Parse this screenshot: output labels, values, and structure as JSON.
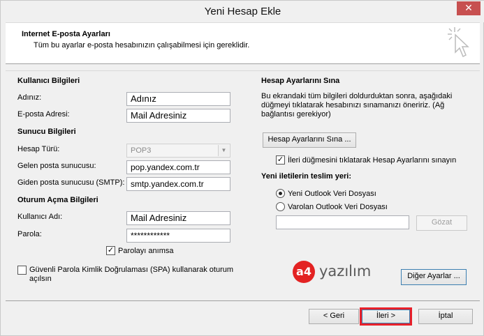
{
  "window": {
    "title": "Yeni Hesap Ekle",
    "close_label": "✕"
  },
  "header": {
    "title": "Internet E-posta Ayarları",
    "subtitle": "Tüm bu ayarlar e-posta hesabınızın çalışabilmesi için gereklidir."
  },
  "left": {
    "user_section": "Kullanıcı Bilgileri",
    "name_label": "Adınız:",
    "name_value": "Adınız",
    "email_label": "E-posta Adresi:",
    "email_value": "Mail Adresiniz",
    "server_section": "Sunucu Bilgileri",
    "account_type_label": "Hesap Türü:",
    "account_type_value": "POP3",
    "incoming_label": "Gelen posta sunucusu:",
    "incoming_value": "pop.yandex.com.tr",
    "outgoing_label": "Giden posta sunucusu (SMTP):",
    "outgoing_value": "smtp.yandex.com.tr",
    "logon_section": "Oturum Açma Bilgileri",
    "username_label": "Kullanıcı Adı:",
    "username_value": "Mail Adresiniz",
    "password_label": "Parola:",
    "password_value": "************",
    "remember_label": "Parolayı anımsa",
    "remember_checked": true,
    "spa_label_1": "Güvenli Parola Kimlik Doğrulaması (SPA) kullanarak oturum",
    "spa_label_2": "açılsın",
    "spa_checked": false
  },
  "right": {
    "test_section": "Hesap Ayarlarını Sına",
    "test_desc_1": "Bu ekrandaki tüm bilgileri doldurduktan sonra, aşağıdaki",
    "test_desc_2": "düğmeyi tıklatarak hesabınızı sınamanızı öneririz. (Ağ",
    "test_desc_3": "bağlantısı gerekiyor)",
    "test_button": "Hesap Ayarlarını Sına ...",
    "auto_test_label": "İleri düğmesini tıklatarak Hesap Ayarlarını sınayın",
    "auto_test_checked": true,
    "delivery_section": "Yeni iletilerin teslim yeri:",
    "new_pst_label": "Yeni Outlook Veri Dosyası",
    "existing_pst_label": "Varolan Outlook Veri Dosyası",
    "browse_button": "Gözat",
    "more_settings_button": "Diğer Ayarlar ..."
  },
  "logo": {
    "mark": "a4",
    "text": "yazılım",
    "color": "#e32222"
  },
  "footer": {
    "back_button": "< Geri",
    "next_button": "İleri >",
    "cancel_button": "İptal",
    "highlight_color": "#e8202a"
  }
}
